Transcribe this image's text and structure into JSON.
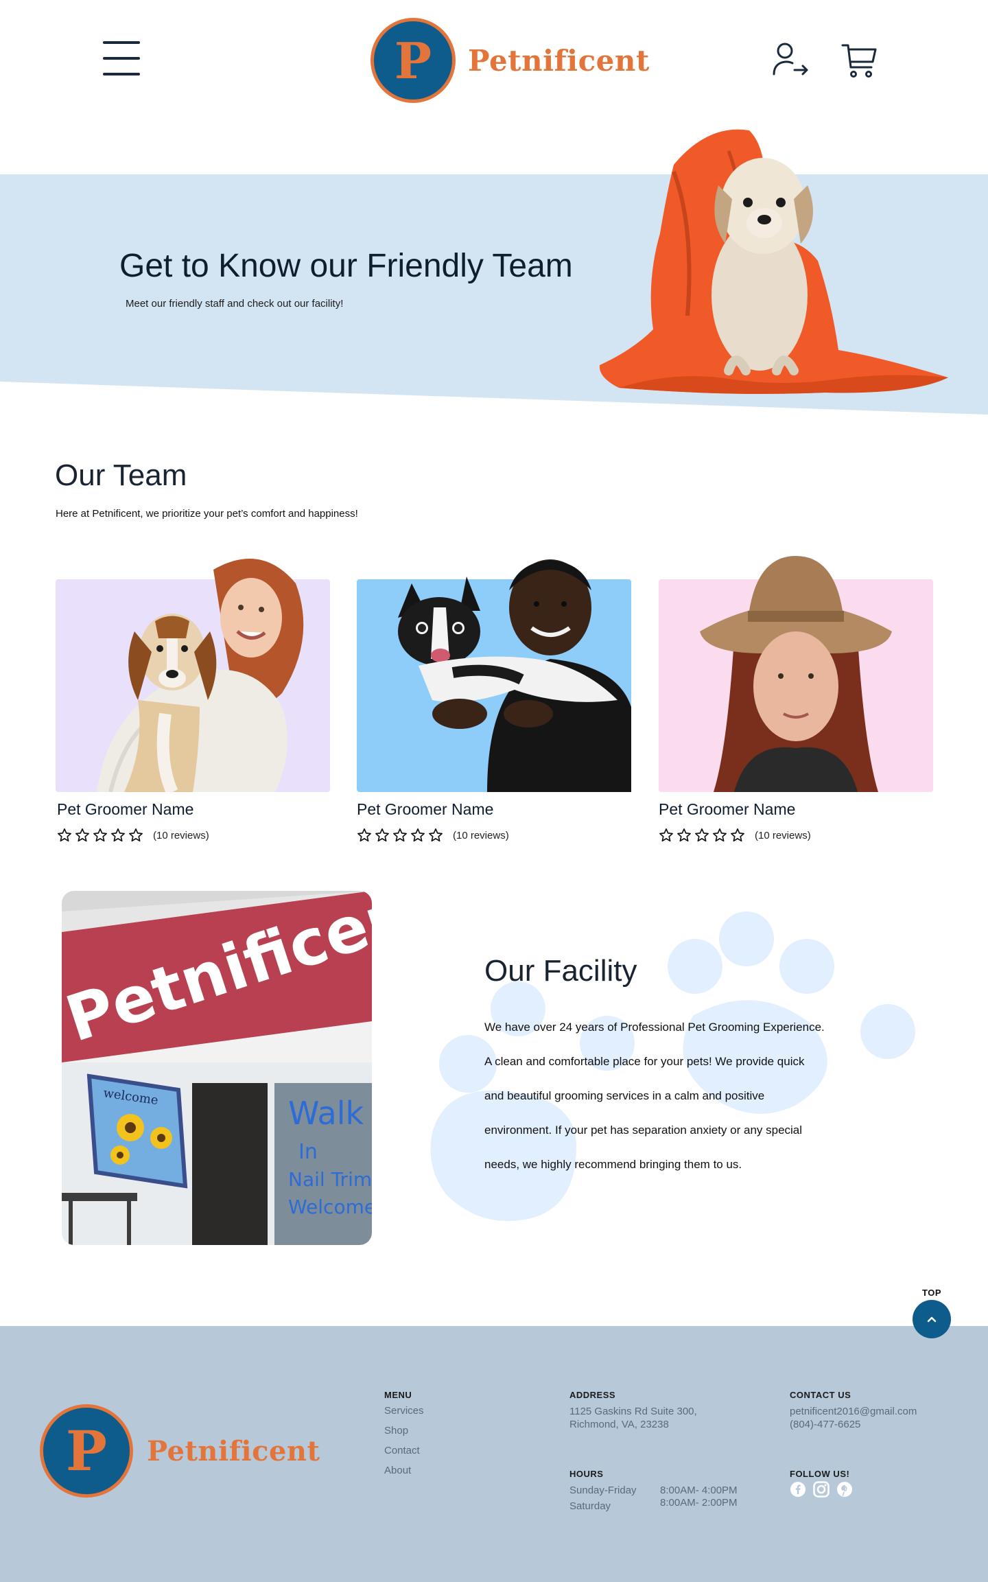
{
  "header": {
    "brand": "Petnificent",
    "logo_letter": "P"
  },
  "hero": {
    "title": "Get to Know our Friendly Team",
    "subtitle": "Meet our friendly staff and check out our facility!"
  },
  "team": {
    "title": "Our Team",
    "subtitle": "Here at Petnificent, we prioritize your pet’s comfort and happiness!",
    "members": [
      {
        "name": "Pet Groomer Name",
        "reviews": "(10 reviews)",
        "bg_color": "#e9e0fc"
      },
      {
        "name": "Pet Groomer Name",
        "reviews": "(10 reviews)",
        "bg_color": "#8ecdf9"
      },
      {
        "name": "Pet Groomer Name",
        "reviews": "(10 reviews)",
        "bg_color": "#fbdcef"
      }
    ]
  },
  "facility": {
    "title": "Our Facility",
    "lines": [
      "We have over 24 years of Professional Pet Grooming Experience.",
      "A clean and comfortable place for your pets! We provide quick",
      "and beautiful grooming services in a calm and positive",
      "environment. If your pet has separation anxiety or any special",
      "needs, we highly recommend bringing them to us."
    ],
    "sign_text": "Petnificent",
    "flag_text": "welcome",
    "window_text": [
      "Walk",
      "In",
      "Nail Trim",
      "Welcome"
    ]
  },
  "top_button": {
    "label": "TOP"
  },
  "footer": {
    "brand": "Petnificent",
    "logo_letter": "P",
    "menu": {
      "heading": "MENU",
      "items": [
        "Services",
        "Shop",
        "Contact",
        "About"
      ]
    },
    "address": {
      "heading": "ADDRESS",
      "line1": "1125 Gaskins Rd Suite 300,",
      "line2": "Richmond, VA, 23238"
    },
    "contact": {
      "heading": "CONTACT US",
      "email": "petnificent2016@gmail.com",
      "phone": "(804)-477-6625"
    },
    "hours": {
      "heading": "HOURS",
      "rows": [
        {
          "day": "Sunday-Friday",
          "time": "8:00AM- 4:00PM"
        },
        {
          "day": "Saturday",
          "time": "8:00AM- 2:00PM"
        }
      ]
    },
    "follow": {
      "heading": "FOLLOW US!",
      "icons": [
        "facebook-icon",
        "instagram-icon",
        "pinterest-icon"
      ]
    }
  },
  "colors": {
    "brand_orange": "#e3743a",
    "brand_blue": "#0e5c8c",
    "hero_bg": "#d3e4f3",
    "footer_bg": "#b7c9d9",
    "paw": "#e2efff"
  }
}
